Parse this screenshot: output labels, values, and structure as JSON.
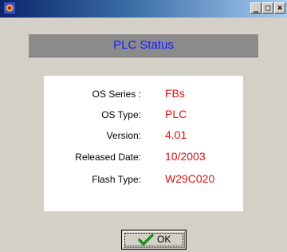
{
  "titlebar": {
    "icon": "app-shield-icon",
    "min_label": "_",
    "max_label": "□",
    "close_label": "×"
  },
  "header": {
    "title": "PLC Status"
  },
  "info": {
    "rows": [
      {
        "label": "OS Series :",
        "value": "FBs"
      },
      {
        "label": "OS Type:",
        "value": "PLC"
      },
      {
        "label": "Version:",
        "value": "4.01"
      },
      {
        "label": "Released Date:",
        "value": "10/2003"
      },
      {
        "label": "Flash Type:",
        "value": "W29C020"
      }
    ]
  },
  "ok_button": {
    "label": "OK",
    "icon": "checkmark-icon"
  },
  "colors": {
    "header_text": "#1a1aff",
    "value_text": "#e01010",
    "title_gradient_start": "#0a246a",
    "title_gradient_end": "#a6caf0"
  }
}
